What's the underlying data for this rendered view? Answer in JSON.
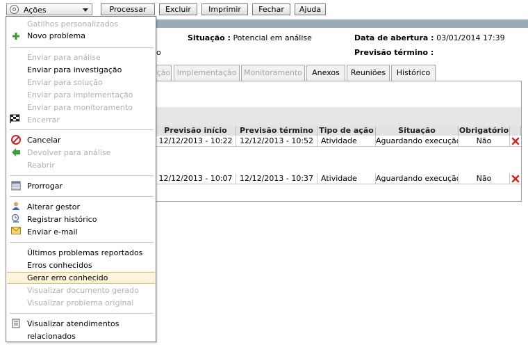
{
  "toolbar": {
    "actions_label": "Ações",
    "buttons": [
      "Processar",
      "Excluir",
      "Imprimir",
      "Fechar",
      "Ajuda"
    ]
  },
  "header": {
    "situacao_label": "Situação :",
    "situacao_value": "Potencial em análise",
    "abertura_label": "Data de abertura :",
    "abertura_value": "03/01/2014 17:39",
    "previsao_label": "Previsão término :",
    "partial_text": "o"
  },
  "tabs": [
    {
      "label": "ção",
      "disabled": true
    },
    {
      "label": "Implementação",
      "disabled": true
    },
    {
      "label": "Monitoramento",
      "disabled": true
    },
    {
      "label": "Anexos",
      "disabled": false
    },
    {
      "label": "Reuniões",
      "disabled": false
    },
    {
      "label": "Histórico",
      "disabled": false
    }
  ],
  "table": {
    "columns": [
      "Previsão início",
      "Previsão término",
      "Tipo de ação",
      "Situação",
      "Obrigatório"
    ],
    "rows": [
      [
        "12/12/2013 - 10:22",
        "12/12/2013 - 10:52",
        "Atividade",
        "Aguardando execução",
        "Não"
      ],
      [
        "12/12/2013 - 10:07",
        "12/12/2013 - 10:37",
        "Atividade",
        "Aguardando execução",
        "Não"
      ]
    ]
  },
  "menu": {
    "items": [
      {
        "label": "Gatilhos personalizados",
        "enabled": false
      },
      {
        "label": "Novo problema",
        "enabled": true,
        "icon": "plus-icon"
      },
      {
        "label": "Enviar para análise",
        "enabled": false
      },
      {
        "label": "Enviar para investigação",
        "enabled": true
      },
      {
        "label": "Enviar para solução",
        "enabled": false
      },
      {
        "label": "Enviar para implementação",
        "enabled": false
      },
      {
        "label": "Enviar para monitoramento",
        "enabled": false
      },
      {
        "label": "Encerrar",
        "enabled": false,
        "icon": "finish-flag-icon"
      },
      {
        "label": "Cancelar",
        "enabled": true,
        "icon": "cancel-icon"
      },
      {
        "label": "Devolver para análise",
        "enabled": false,
        "icon": "back-arrow-icon"
      },
      {
        "label": "Reabrir",
        "enabled": false
      },
      {
        "label": "Prorrogar",
        "enabled": true,
        "icon": "calendar-icon"
      },
      {
        "label": "Alterar gestor",
        "enabled": true,
        "icon": "user-icon"
      },
      {
        "label": "Registrar histórico",
        "enabled": true,
        "icon": "history-icon"
      },
      {
        "label": "Enviar e-mail",
        "enabled": true,
        "icon": "envelope-icon"
      },
      {
        "label": "Últimos problemas reportados",
        "enabled": true
      },
      {
        "label": "Erros conhecidos",
        "enabled": true
      },
      {
        "label": "Gerar erro conhecido",
        "enabled": true,
        "highlighted": true
      },
      {
        "label": "Visualizar documento gerado",
        "enabled": false
      },
      {
        "label": "Visualizar problema original",
        "enabled": false
      },
      {
        "label": "Visualizar atendimentos",
        "enabled": true,
        "icon": "document-list-icon"
      },
      {
        "label": "relacionados",
        "enabled": true
      }
    ]
  },
  "colors": {
    "header_band": "#9aaab6",
    "highlight": "#fdf4dc",
    "delete": "#e02020"
  }
}
